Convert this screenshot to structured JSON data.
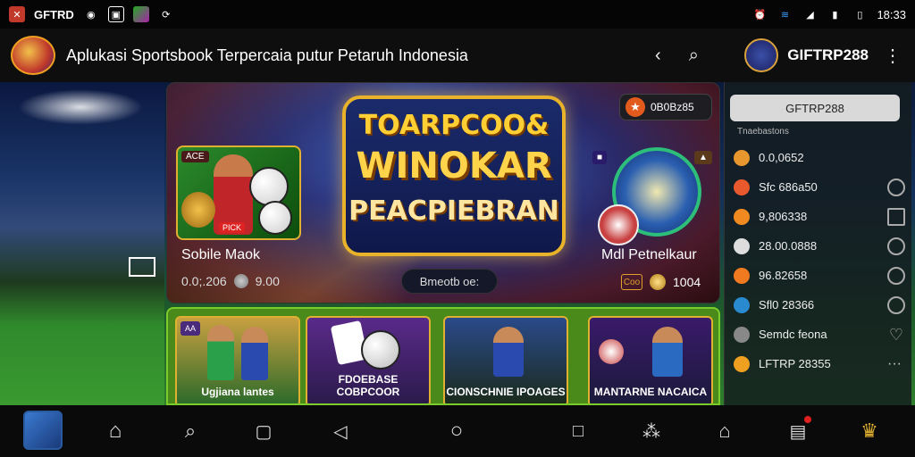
{
  "status_bar": {
    "carrier_label": "GFTRD",
    "time": "18:33"
  },
  "app_bar": {
    "title": "Aplukasi Sportsbook Terpercaia putur Petaruh Indonesia",
    "brand_name": "GIFTRP288",
    "icons": [
      "back-icon",
      "search-icon",
      "more-icon"
    ]
  },
  "hero": {
    "title_line1": "TOARPCOO&",
    "title_line2": "WINOKAR",
    "title_line3": "PEACPIEBRAN",
    "left_card_tag": "ACE",
    "left_card_tag2": "PICK",
    "left_label": "Sobile Maok",
    "left_sub_value": "0.0;.206",
    "left_sub_value2": "9.00",
    "center_pill": "Bmeotb oe:",
    "top_right_pill": "0B0Bz85",
    "right_label": "Mdl Petnelkaur",
    "right_box": "Coo",
    "right_value": "1004"
  },
  "side_panel": {
    "button": "GFTRP288",
    "heading": "Tnaebastons",
    "rows": [
      {
        "label": "0.0,0652",
        "icon_color": "#e8962e",
        "control": "none"
      },
      {
        "label": "Sfc 686a50",
        "icon_color": "#e85a2e",
        "control": "circle"
      },
      {
        "label": "9,806338",
        "icon_color": "#f08a20",
        "control": "square"
      },
      {
        "label": "28.00.0888",
        "icon_color": "#dddddd",
        "control": "circle"
      },
      {
        "label": "96.82658",
        "icon_color": "#f07a20",
        "control": "circle"
      },
      {
        "label": "Sfl0 28366",
        "icon_color": "#2a8ad0",
        "control": "circle"
      },
      {
        "label": "Semdc feona",
        "icon_color": "#888888",
        "control": "heart"
      },
      {
        "label": "LFTRP 28355",
        "icon_color": "#f0a020",
        "control": "dots"
      }
    ]
  },
  "tiles": [
    {
      "tag": "AA",
      "label": "Ugjiana lantes"
    },
    {
      "tag": "",
      "label": "FDOEBASE COBPCOOR"
    },
    {
      "tag": "",
      "label": "CIONSCHNIE IPOAGES"
    },
    {
      "tag": "",
      "label": "MANTARNE NACAICA"
    }
  ],
  "nav_bar": {
    "icons": [
      "avatar",
      "home-icon",
      "search-icon",
      "edit-icon",
      "back-triangle-icon",
      "home-circle-icon",
      "recents-square-icon",
      "share-icon",
      "house-outline-icon",
      "inbox-icon",
      "logo-icon"
    ]
  },
  "colors": {
    "accent_gold": "#e0b030",
    "green": "#4a8a1a",
    "hero_bg": "#2a2a6a"
  }
}
